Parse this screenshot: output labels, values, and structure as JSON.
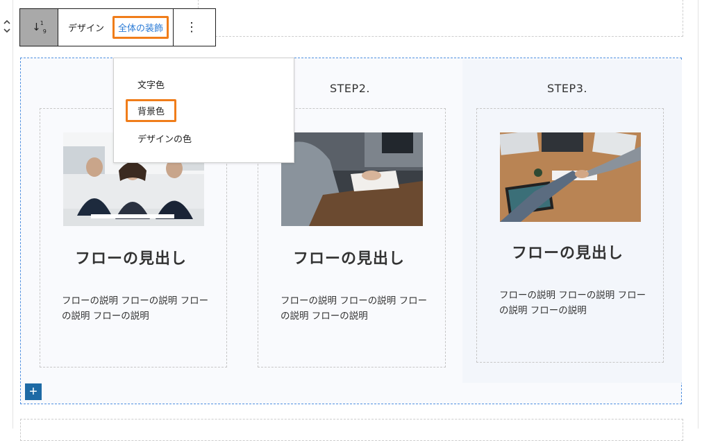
{
  "toolbar": {
    "design_label": "デザイン",
    "overall_decoration_label": "全体の装飾",
    "more_label": "⋮"
  },
  "dropdown": {
    "items": [
      "文字色",
      "背景色",
      "デザインの色"
    ]
  },
  "flow": {
    "steps": [
      {
        "step": "",
        "title": "フローの見出し",
        "description": "フローの説明 フローの説明 フローの説明 フローの説明"
      },
      {
        "step": "STEP2.",
        "title": "フローの見出し",
        "description": "フローの説明 フローの説明 フローの説明 フローの説明"
      },
      {
        "step": "STEP3.",
        "title": "フローの見出し",
        "description": "フローの説明 フローの説明 フローの説明 フローの説明"
      }
    ],
    "add_label": "+"
  },
  "colors": {
    "highlight": "#f07d1a",
    "accent_link": "#2b7bd6",
    "add_button": "#1e6aa5",
    "block_outline": "#4e8fe0"
  },
  "icons": {
    "block_type": "sort-numbered-icon",
    "mover": "chevron-up-down-icon",
    "more": "vertical-ellipsis-icon"
  }
}
